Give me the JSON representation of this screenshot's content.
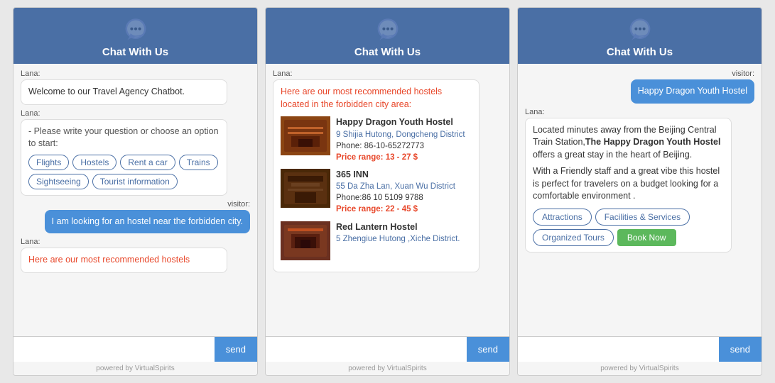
{
  "header": {
    "title": "Chat With Us"
  },
  "panel1": {
    "lana_label": "Lana:",
    "visitor_label": "visitor:",
    "msg1": "Welcome to our Travel Agency Chatbot.",
    "msg2_intro": "- Please write your question or choose an option to start:",
    "buttons": [
      "Flights",
      "Hostels",
      "Rent a car",
      "Trains",
      "Sightseeing",
      "Tourist information"
    ],
    "visitor_msg": "I am looking for an hostel near the forbidden city.",
    "msg3_partial": "Here are our most recommended hostels",
    "input_placeholder": "",
    "send_label": "send",
    "footer": "powered by VirtualSpirits"
  },
  "panel2": {
    "lana_label": "Lana:",
    "intro_msg": "Here are our most recommended hostels located in the forbidden city area:",
    "hostels": [
      {
        "name": "Happy Dragon Youth Hostel",
        "address": "9 Shijia Hutong, Dongcheng District",
        "phone": "Phone: 86-10-65272773",
        "price_label": "Price range:",
        "price_value": "13 - 27 $",
        "img_bg": "#8B4513",
        "img_char": "🏮"
      },
      {
        "name": "365 INN",
        "address": "55 Da Zha Lan, Xuan Wu District",
        "phone": "Phone:86 10 5109 9788",
        "price_label": "Price range:",
        "price_value": "22 - 45 $",
        "img_bg": "#5a3010",
        "img_char": "🏯"
      },
      {
        "name": "Red Lantern Hostel",
        "address": "5 Zhengiue Hutong ,Xiche District.",
        "phone": "",
        "price_label": "",
        "price_value": "",
        "img_bg": "#6b3020",
        "img_char": "🏮"
      }
    ],
    "send_label": "send",
    "footer": "powered by VirtualSpirits"
  },
  "panel3": {
    "lana_label": "Lana:",
    "visitor_label": "visitor:",
    "visitor_msg": "Happy Dragon Youth Hostel",
    "description_p1": "Located minutes away from the Beijing Central Train Station,",
    "description_bold": "The Happy Dragon Youth Hostel",
    "description_p1_end": " offers a great stay in the heart of Beijing.",
    "description_p2": "With a Friendly staff and a great vibe this hostel is perfect for travelers on a budget looking for a comfortable environment .",
    "action_buttons": [
      "Attractions",
      "Facilities & Services",
      "Organized Tours"
    ],
    "book_now": "Book Now",
    "send_label": "send",
    "footer": "powered by VirtualSpirits"
  },
  "icons": {
    "chat_bubble": "💬"
  }
}
